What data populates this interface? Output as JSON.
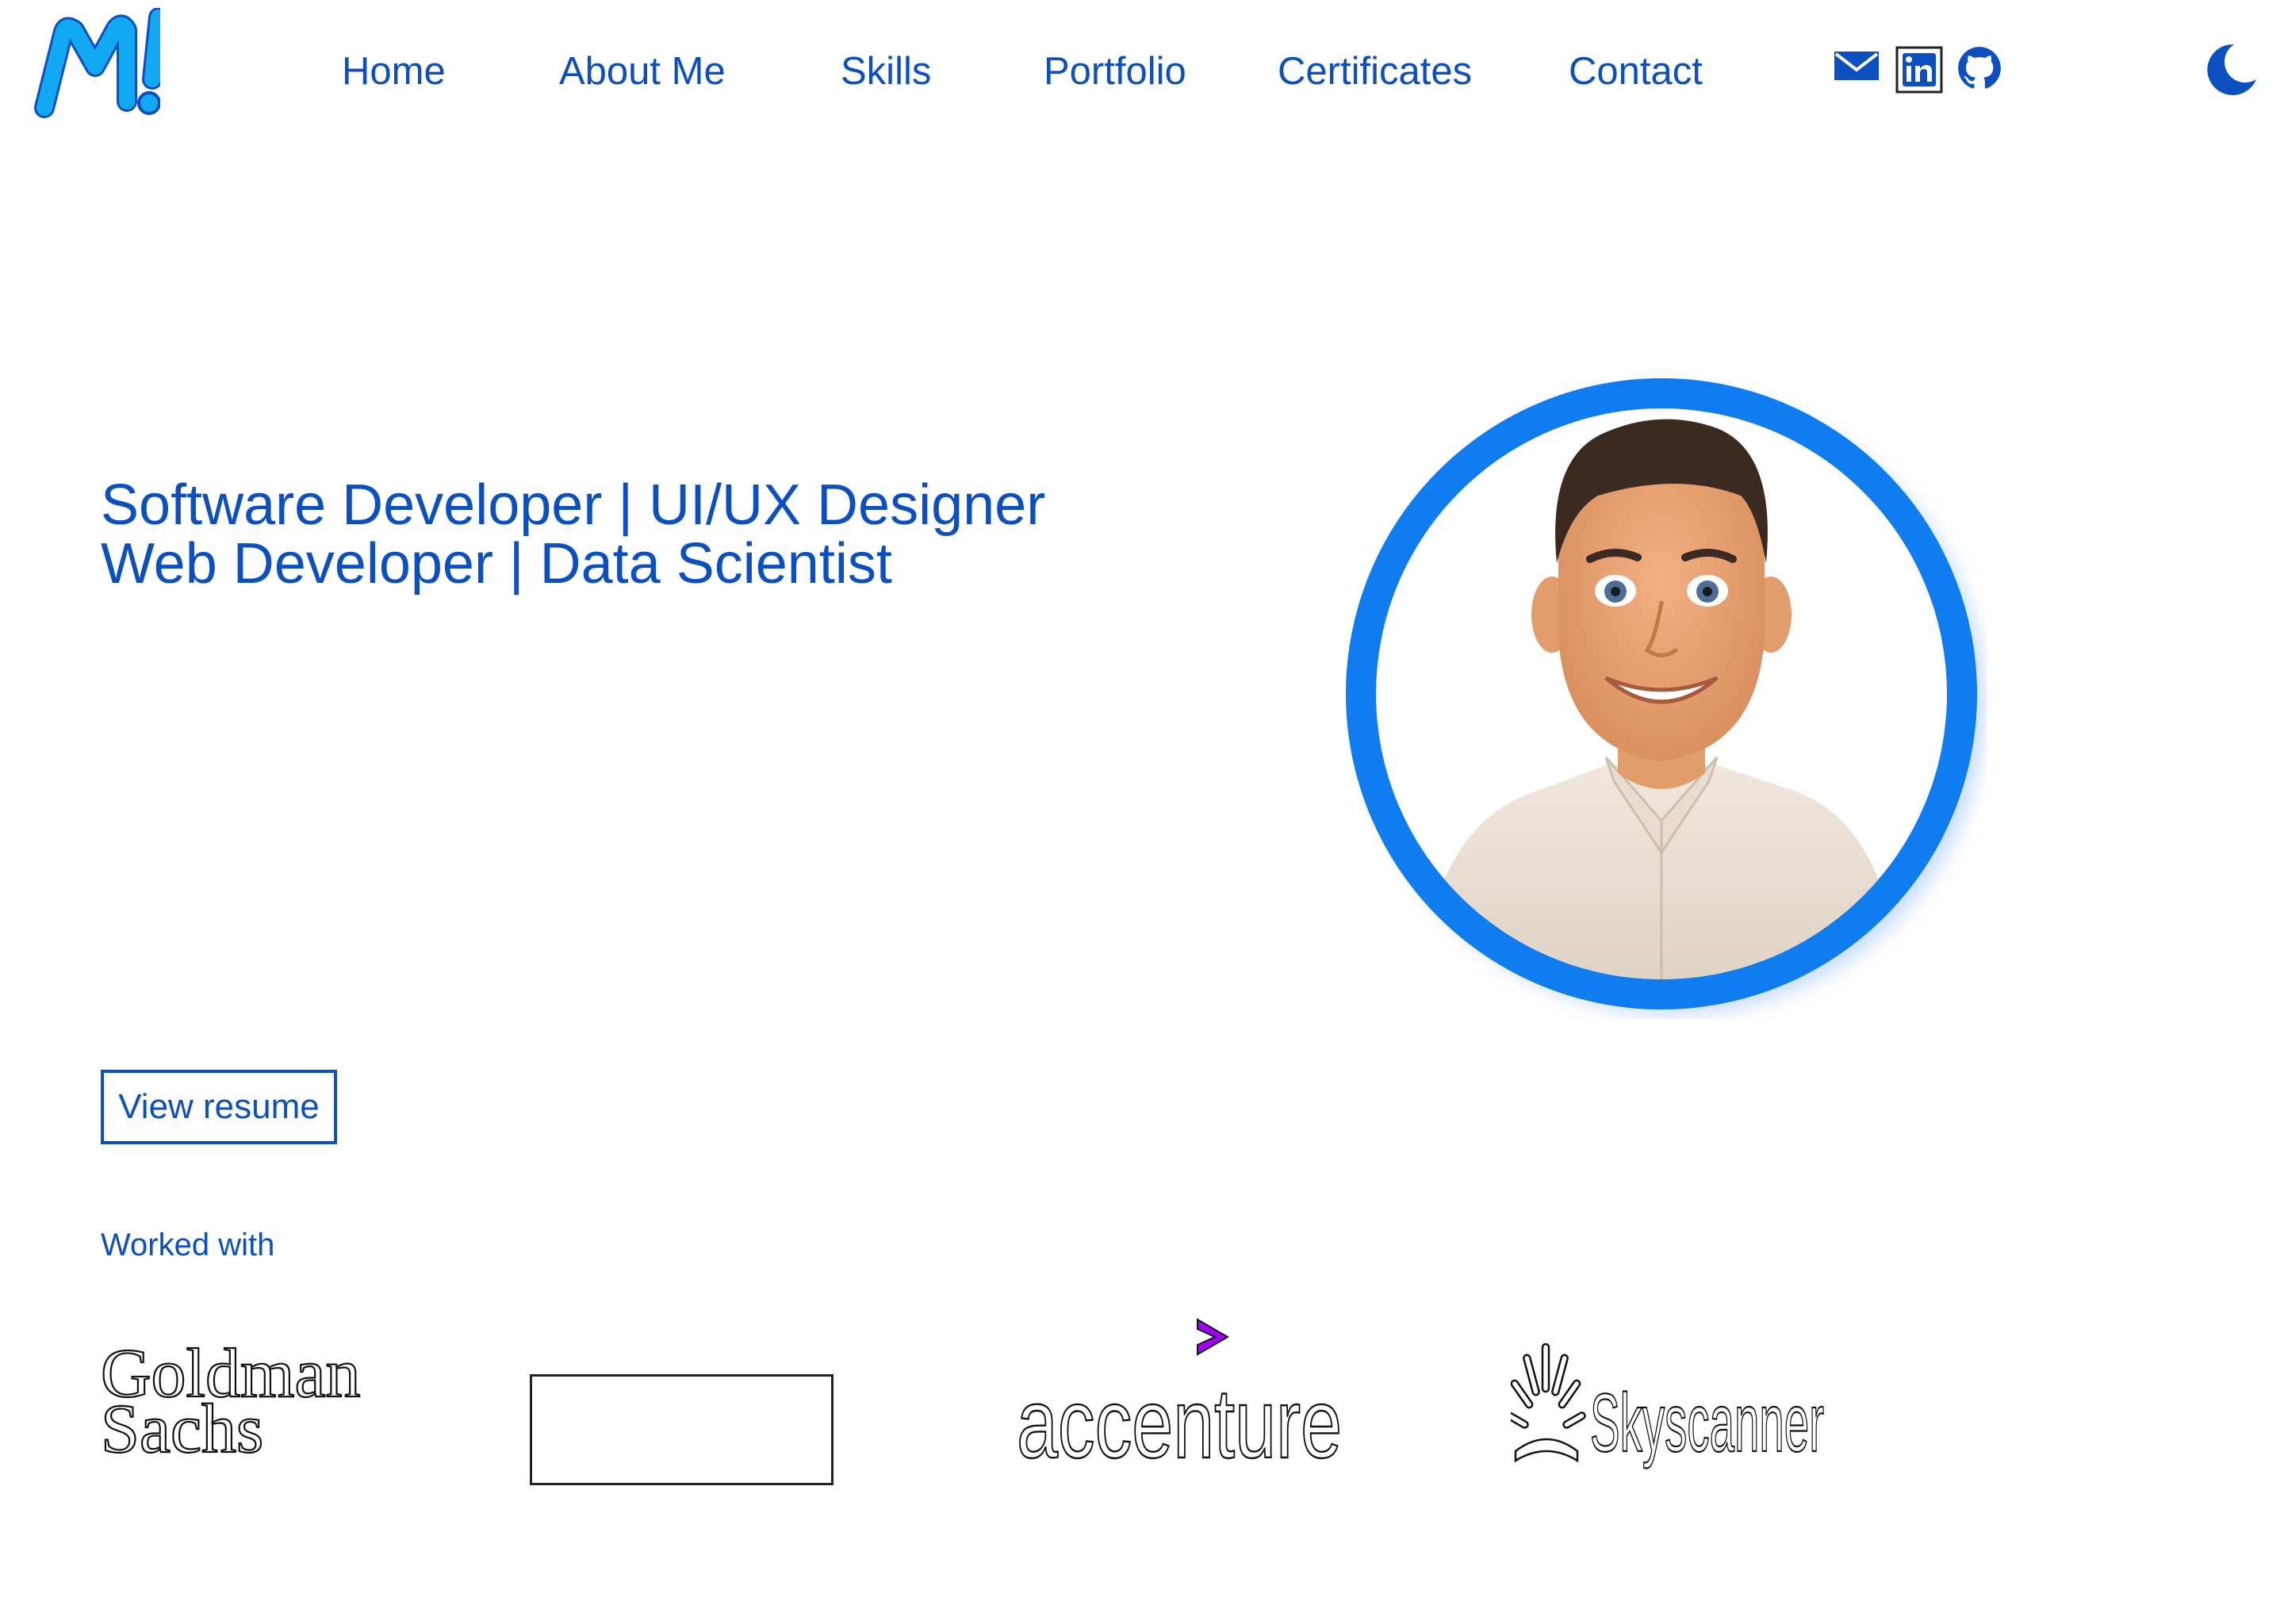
{
  "brand": {
    "logo_text": "M!",
    "colors": {
      "accent": "#0b4fc1",
      "logo": "#11a9f2",
      "ring": "#0f7cf0",
      "accenture_arrow": "#a100ff"
    }
  },
  "nav": {
    "items": [
      {
        "label": "Home"
      },
      {
        "label": "About Me"
      },
      {
        "label": "Skills"
      },
      {
        "label": "Portfolio"
      },
      {
        "label": "Certificates"
      },
      {
        "label": "Contact"
      }
    ]
  },
  "social": {
    "icons": [
      "mail-icon",
      "linkedin-icon",
      "github-icon"
    ]
  },
  "theme_toggle": {
    "icon": "moon-icon"
  },
  "hero": {
    "title_line1": "Software Developer | UI/UX Designer",
    "title_line2": "Web Developer | Data Scientist",
    "resume_label": "View resume",
    "worked_with_label": "Worked with"
  },
  "companies": {
    "goldman_line1": "Goldman",
    "goldman_line2": "Sachs",
    "accenture": "accenture",
    "skyscanner": "Skyscanner"
  }
}
